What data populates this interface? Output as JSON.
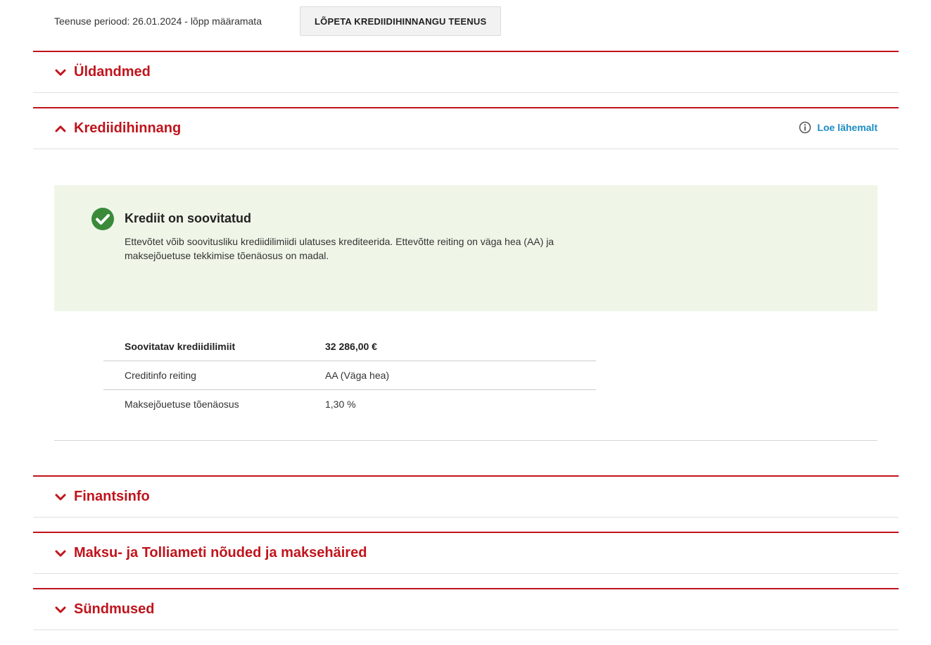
{
  "service": {
    "period_text": "Teenuse periood: 26.01.2024 - lõpp määramata",
    "end_button_label": "LÕPETA KREDIIDIHINNANGU TEENUS"
  },
  "sections": {
    "general": {
      "title": "Üldandmed",
      "expanded": false
    },
    "credit": {
      "title": "Krediidihinnang",
      "expanded": true,
      "read_more_label": "Loe lähemalt"
    },
    "finance": {
      "title": "Finantsinfo",
      "expanded": false
    },
    "tax": {
      "title": "Maksu- ja Tolliameti nõuded ja maksehäired",
      "expanded": false
    },
    "events": {
      "title": "Sündmused",
      "expanded": false
    }
  },
  "recommendation": {
    "title": "Krediit on soovitatud",
    "text": "Ettevõtet võib soovitusliku krediidilimiidi ulatuses krediteerida. Ettevõtte reiting on väga hea (AA) ja maksejõuetuse tekkimise tõenäosus on madal.",
    "icon": "check-circle-icon"
  },
  "credit_table": {
    "rows": [
      {
        "label": "Soovitatav krediidilimiit",
        "value": "32 286,00 €"
      },
      {
        "label": "Creditinfo reiting",
        "value": "AA  (Väga hea)"
      },
      {
        "label": "Maksejõuetuse tõenäosus",
        "value": "1,30  %"
      }
    ]
  },
  "colors": {
    "accent": "#c0141c",
    "link": "#1c8cc4",
    "success": "#3a8a3a",
    "alert_bg": "#eff6e8"
  }
}
